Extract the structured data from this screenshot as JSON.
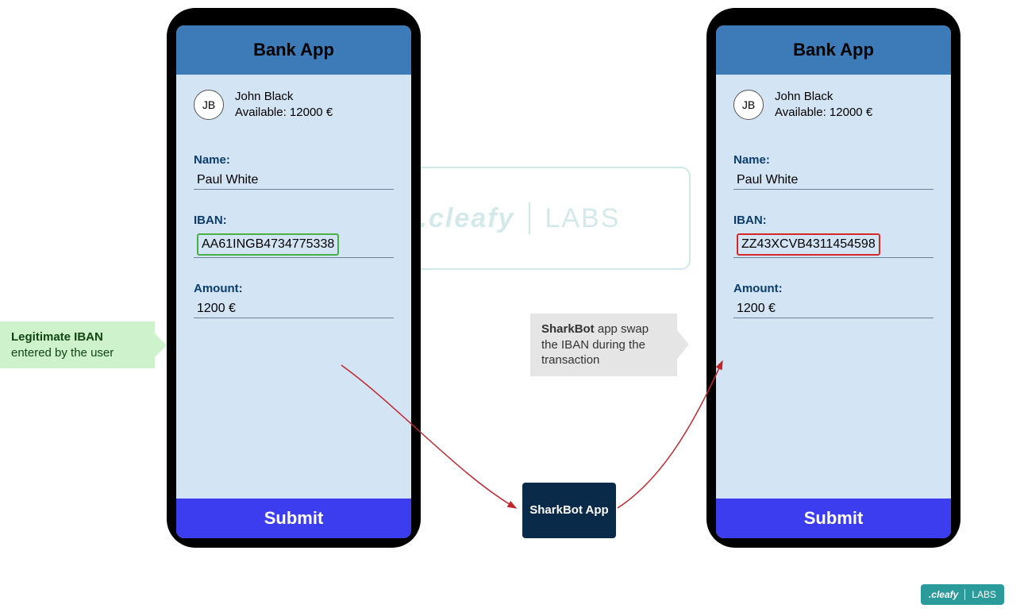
{
  "app_title": "Bank App",
  "user": {
    "initials": "JB",
    "name": "John Black",
    "available_label": "Available: 12000 €"
  },
  "fields": {
    "name_label": "Name:",
    "name_value": "Paul White",
    "iban_label": "IBAN:",
    "amount_label": "Amount:",
    "amount_value": "1200 €"
  },
  "phone_left": {
    "iban_value": "AA61INGB4734775338"
  },
  "phone_right": {
    "iban_value": "ZZ43XCVB4311454598"
  },
  "submit_label": "Submit",
  "callouts": {
    "legitimate_bold": "Legitimate IBAN",
    "legitimate_rest": " entered by the user",
    "swap_bold": "SharkBot",
    "swap_rest": " app swap the IBAN during the transaction"
  },
  "sharkbot_box": "SharkBot App",
  "watermark": {
    "left": ".cleafy",
    "right": "LABS"
  },
  "badge": {
    "left": ".cleafy",
    "right": "LABS"
  }
}
